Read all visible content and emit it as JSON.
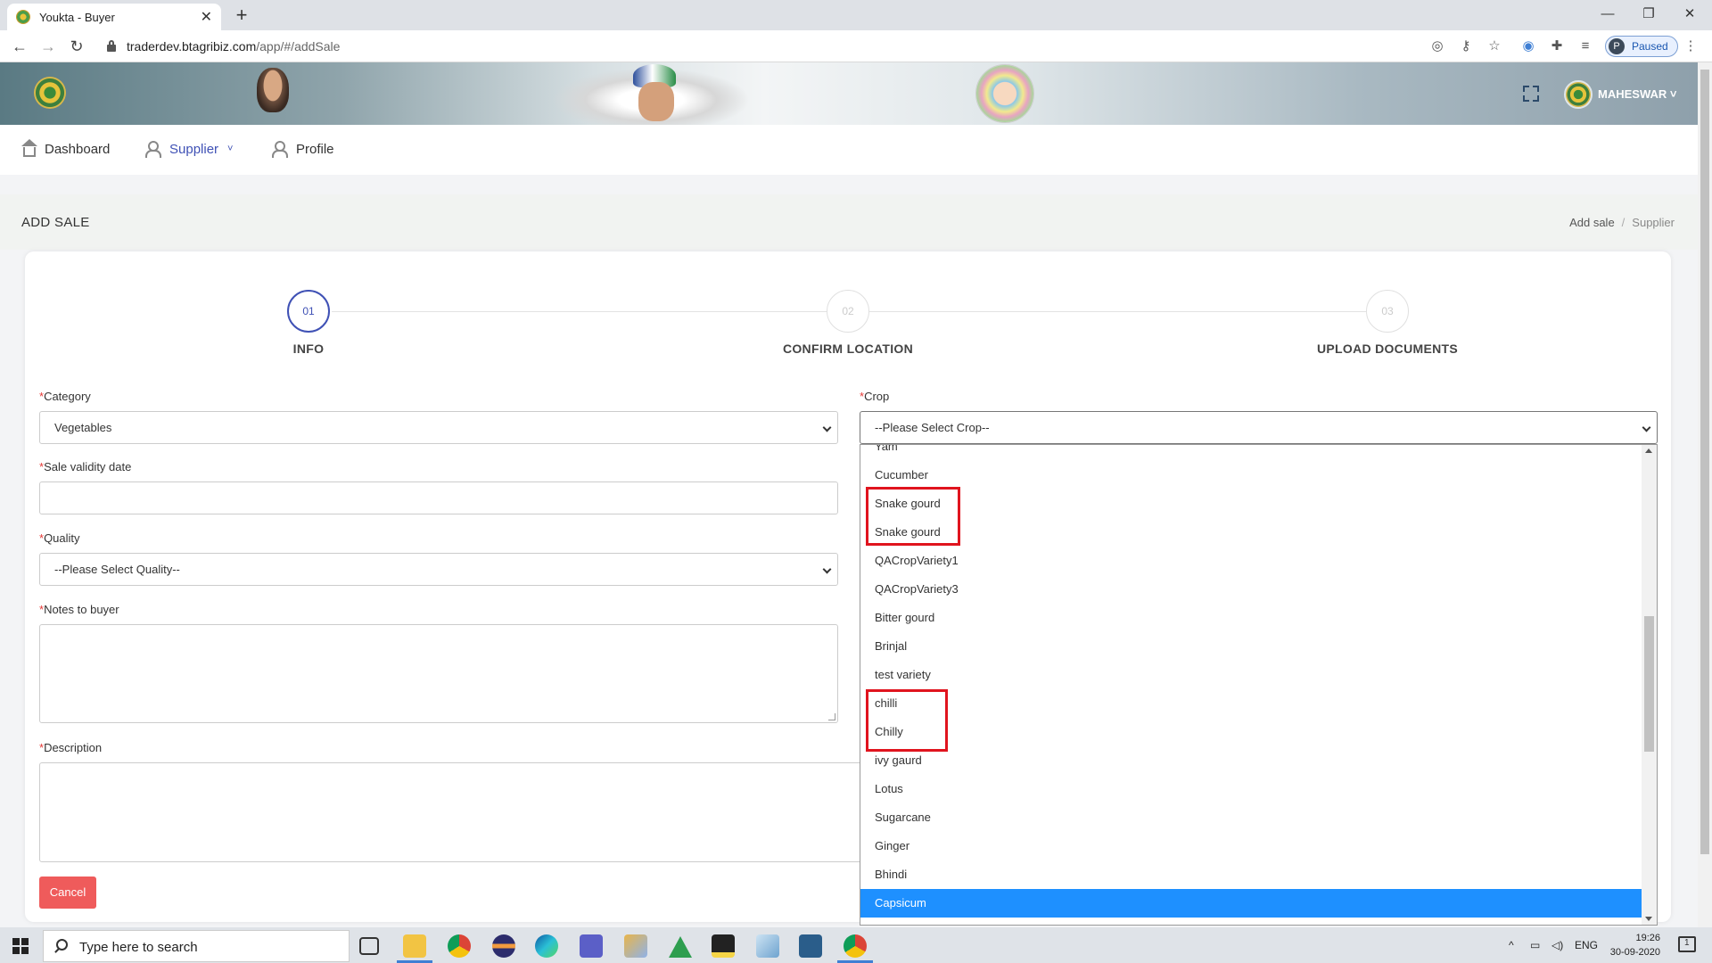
{
  "browser": {
    "tab_title": "Youkta - Buyer",
    "tab_close": "✕",
    "new_tab": "+",
    "win_min": "—",
    "win_max": "❐",
    "win_close": "✕",
    "back": "←",
    "forward": "→",
    "reload": "↻",
    "url_host": "traderdev.btagribiz.com",
    "url_path": "/app/#/addSale",
    "profile_initial": "P",
    "profile_status": "Paused",
    "icons": [
      "location-icon",
      "key-icon",
      "star-icon",
      "extension-icon",
      "puzzle-icon",
      "reading-list-icon",
      "menu-icon"
    ]
  },
  "header": {
    "user_name": "MAHESWAR ˅"
  },
  "nav": {
    "dashboard": "Dashboard",
    "supplier": "Supplier",
    "profile": "Profile",
    "chevron": "˅"
  },
  "page": {
    "title": "ADD SALE",
    "breadcrumb": [
      "Add sale",
      "Supplier"
    ],
    "breadcrumb_sep": "/"
  },
  "steps": [
    {
      "num": "01",
      "label": "INFO",
      "active": true
    },
    {
      "num": "02",
      "label": "CONFIRM LOCATION",
      "active": false
    },
    {
      "num": "03",
      "label": "UPLOAD DOCUMENTS",
      "active": false
    }
  ],
  "form": {
    "req_mark": "*",
    "category_label": "Category",
    "category_value": "Vegetables",
    "crop_label": "Crop",
    "crop_value": "--Please Select Crop--",
    "validity_label": "Sale validity date",
    "quality_label": "Quality",
    "quality_value": "--Please Select Quality--",
    "notes_label": "Notes to buyer",
    "description_label": "Description",
    "cancel": "Cancel"
  },
  "crop_options": [
    "Yam",
    "Cucumber",
    "Snake gourd",
    "Snake gourd",
    "QACropVariety1",
    "QACropVariety3",
    "Bitter gourd",
    "Brinjal",
    "test variety",
    "chilli",
    "Chilly",
    "ivy gaurd",
    "Lotus",
    "Sugarcane",
    "Ginger",
    "Bhindi",
    "Capsicum"
  ],
  "crop_selected": "Capsicum",
  "taskbar": {
    "search_placeholder": "Type here to search",
    "lang": "ENG",
    "time": "19:26",
    "date": "30-09-2020",
    "tray_up": "^",
    "notif_count": "1"
  },
  "colors": {
    "accent": "#3f51b5",
    "cancel": "#ef5b5b",
    "highlight": "#e0141e",
    "selected": "#1e90ff"
  }
}
